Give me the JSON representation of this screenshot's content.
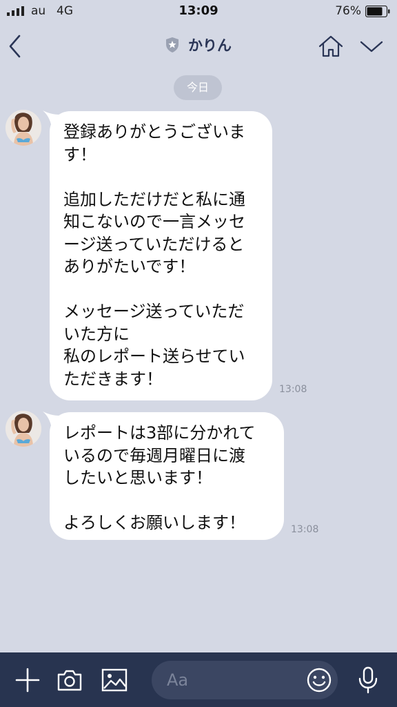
{
  "status_bar": {
    "carrier": "au",
    "network": "4G",
    "time": "13:09",
    "battery_percent": "76%"
  },
  "header": {
    "title": "かりん"
  },
  "date_separator": "今日",
  "messages": [
    {
      "text": "登録ありがとうございま\nす！\n\n追加しただけだと私に通\n知こないので一言メッセ\nージ送っていただけると\nありがたいです！\n\nメッセージ送っていただ\nいた方に\n私のレポート送らせてい\nただきます！",
      "time": "13:08"
    },
    {
      "text": "レポートは3部に分かれて\nいるので毎週月曜日に渡\nしたいと思います！\n\nよろしくお願いします！",
      "time": "13:08"
    }
  ],
  "input": {
    "placeholder": "Aa"
  },
  "icons": {
    "back": "chevron-left-icon",
    "shield": "shield-star-icon",
    "home": "home-icon",
    "menu": "chevron-down-icon",
    "plus": "plus-icon",
    "camera": "camera-icon",
    "image": "image-icon",
    "emoji": "smiley-icon",
    "mic": "microphone-icon"
  },
  "colors": {
    "chat_background": "#d4d8e4",
    "bubble": "#ffffff",
    "header_text": "#2a3556",
    "bottom_bar": "#283450"
  }
}
